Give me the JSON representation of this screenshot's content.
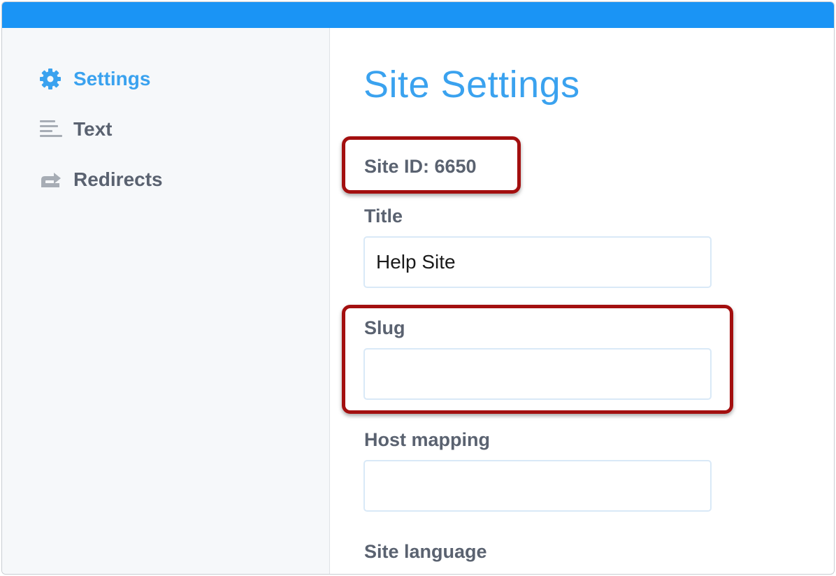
{
  "sidebar": {
    "items": [
      {
        "label": "Settings",
        "icon": "gear-icon",
        "active": true
      },
      {
        "label": "Text",
        "icon": "text-lines-icon",
        "active": false
      },
      {
        "label": "Redirects",
        "icon": "redirect-arrow-icon",
        "active": false
      }
    ]
  },
  "main": {
    "title": "Site Settings",
    "site_id": "Site ID: 6650",
    "fields": [
      {
        "label": "Title",
        "value": "Help Site",
        "placeholder": ""
      },
      {
        "label": "Slug",
        "value": "",
        "placeholder": ""
      },
      {
        "label": "Host mapping",
        "value": "",
        "placeholder": ""
      },
      {
        "label": "Site language"
      }
    ]
  },
  "colors": {
    "topbar": "#1a94f5",
    "accent": "#3aa2ef",
    "highlight": "#a30f0f",
    "label": "#5a6270"
  }
}
